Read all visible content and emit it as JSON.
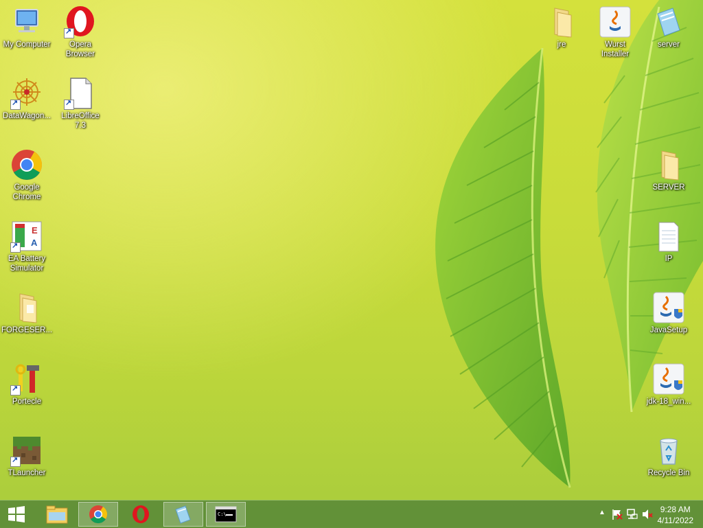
{
  "desktop": {
    "left_icons": [
      {
        "name": "my-computer",
        "label": "My Computer"
      },
      {
        "name": "opera-browser",
        "label": "Opera\nBrowser"
      },
      {
        "name": "datawagon",
        "label": "DataWagon..."
      },
      {
        "name": "libreoffice",
        "label": "LibreOffice\n7.3"
      },
      {
        "name": "google-chrome",
        "label": "Google\nChrome"
      },
      {
        "name": "ea-battery-simulator",
        "label": "EA Battery\nSimulator"
      },
      {
        "name": "forgeser",
        "label": "FORGESER..."
      },
      {
        "name": "portecle",
        "label": "Portecle"
      },
      {
        "name": "tlauncher",
        "label": "TLauncher"
      }
    ],
    "right_icons": [
      {
        "name": "jre",
        "label": "jre"
      },
      {
        "name": "wurst-installer",
        "label": "Wurst\nInstaller"
      },
      {
        "name": "server",
        "label": "server"
      },
      {
        "name": "server-folder",
        "label": "SERVER"
      },
      {
        "name": "ip",
        "label": "IP"
      },
      {
        "name": "javasetup",
        "label": "JavaSetup"
      },
      {
        "name": "jdk-18",
        "label": "jdk-18_win..."
      },
      {
        "name": "recycle-bin",
        "label": "Recycle Bin"
      }
    ]
  },
  "taskbar": {
    "buttons": [
      "start",
      "file-explorer",
      "chrome",
      "opera",
      "notepad",
      "cmd"
    ],
    "clock": {
      "time": "9:28 AM",
      "date": "4/11/2022"
    }
  },
  "colors": {
    "wallpaper": "#c9dc3a",
    "taskbar": "#5c8c38",
    "leaf": "#78c232"
  }
}
